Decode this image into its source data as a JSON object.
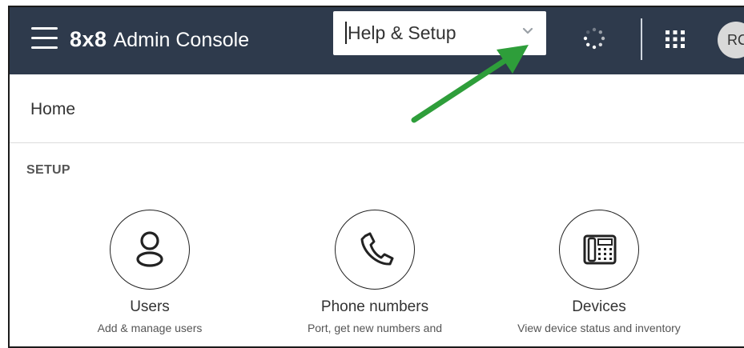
{
  "header": {
    "logo": "8x8",
    "app_name": "Admin Console",
    "menu_select": {
      "value": "Help & Setup"
    },
    "avatar_initials": "RC",
    "colors": {
      "bar": "#2e3a4c",
      "annotation_arrow": "#2e9e3a"
    }
  },
  "page": {
    "breadcrumb": "Home",
    "section_title": "SETUP",
    "tiles": [
      {
        "title": "Users",
        "description": "Add & manage users",
        "icon": "user-icon"
      },
      {
        "title": "Phone numbers",
        "description": "Port, get new numbers and",
        "icon": "phone-icon"
      },
      {
        "title": "Devices",
        "description": "View device status and inventory",
        "icon": "desk-phone-icon"
      }
    ]
  },
  "icons": {
    "menu": "hamburger-menu-icon",
    "chevron": "chevron-down-icon",
    "status": "loading-spinner-icon",
    "apps": "app-grid-icon"
  }
}
